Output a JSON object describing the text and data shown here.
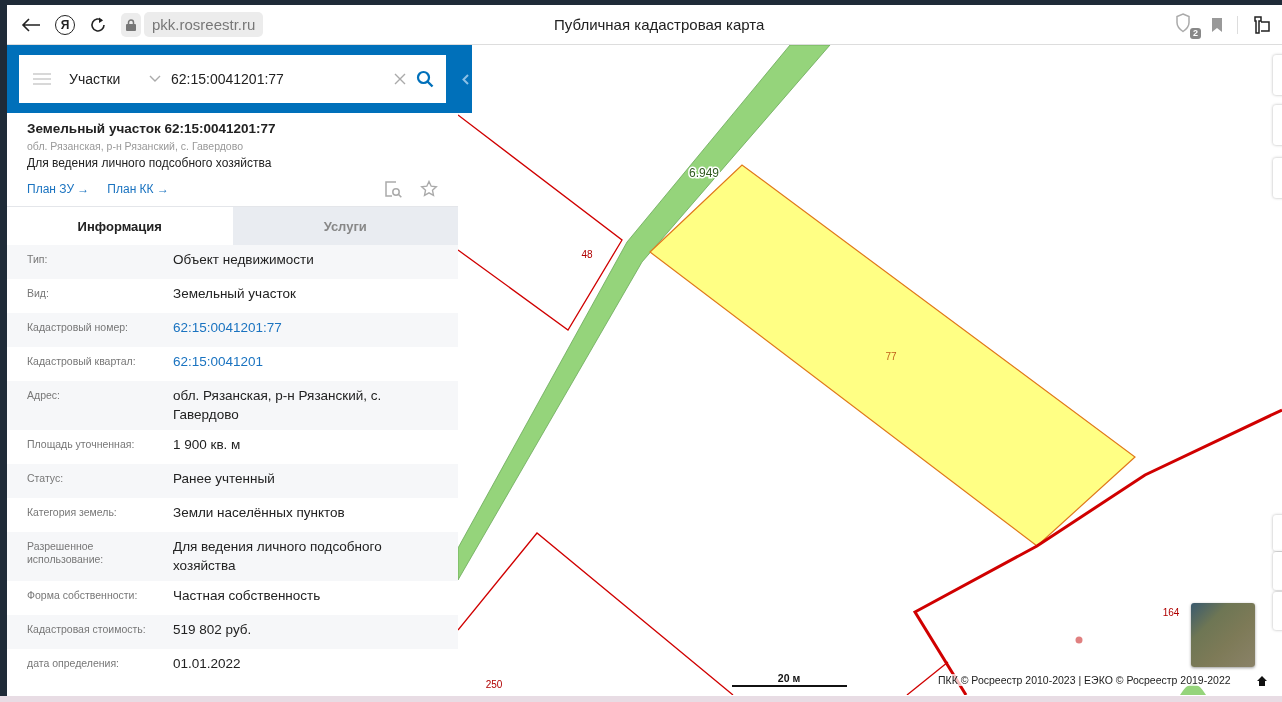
{
  "browser": {
    "logo_letter": "Я",
    "url": "pkk.rosreestr.ru",
    "title": "Публичная кадастровая карта",
    "shield_badge": "2"
  },
  "search": {
    "category": "Участки",
    "value": "62:15:0041201:77"
  },
  "object": {
    "title": "Земельный участок 62:15:0041201:77",
    "address": "обл. Рязанская, р-н Рязанский, с. Гавердово",
    "purpose": "Для ведения личного подсобного хозяйства",
    "links": [
      "План ЗУ →",
      "План КК →"
    ]
  },
  "tabs": [
    {
      "label": "Информация",
      "selected": true
    },
    {
      "label": "Услуги",
      "selected": false
    }
  ],
  "rows": [
    {
      "label": "Тип:",
      "value": "Объект недвижимости",
      "kind": "text"
    },
    {
      "label": "Вид:",
      "value": "Земельный участок",
      "kind": "text"
    },
    {
      "label": "Кадастровый номер:",
      "value": "62:15:0041201:77",
      "kind": "link"
    },
    {
      "label": "Кадастровый квартал:",
      "value": "62:15:0041201",
      "kind": "link"
    },
    {
      "label": "Адрес:",
      "value": "обл. Рязанская, р-н Рязанский, с. Гавердово",
      "kind": "text"
    },
    {
      "label": "Площадь уточненная:",
      "value": "1 900 кв. м",
      "kind": "text"
    },
    {
      "label": "Статус:",
      "value": "Ранее учтенный",
      "kind": "text"
    },
    {
      "label": "Категория земель:",
      "value": "Земли населённых пунктов",
      "kind": "text"
    },
    {
      "label": "Разрешенное использование:",
      "value": "Для ведения личного подсобного хозяйства",
      "kind": "text"
    },
    {
      "label": "Форма собственности:",
      "value": "Частная собственность",
      "kind": "text"
    },
    {
      "label": "Кадастровая стоимость:",
      "value": "519 802 руб.",
      "kind": "text"
    },
    {
      "label": "дата определения:",
      "value": "01.01.2022",
      "kind": "text"
    }
  ],
  "map": {
    "labels": [
      {
        "text": "48",
        "kind": "parcel"
      },
      {
        "text": "6.949",
        "kind": "road"
      },
      {
        "text": "77",
        "kind": "selected"
      },
      {
        "text": "250",
        "kind": "parcel"
      },
      {
        "text": "164",
        "kind": "parcel"
      }
    ],
    "scale": "20 м",
    "attribution": "ПКК © Росреестр 2010-2023 | ЕЭКО © Росреестр 2019-2022"
  }
}
